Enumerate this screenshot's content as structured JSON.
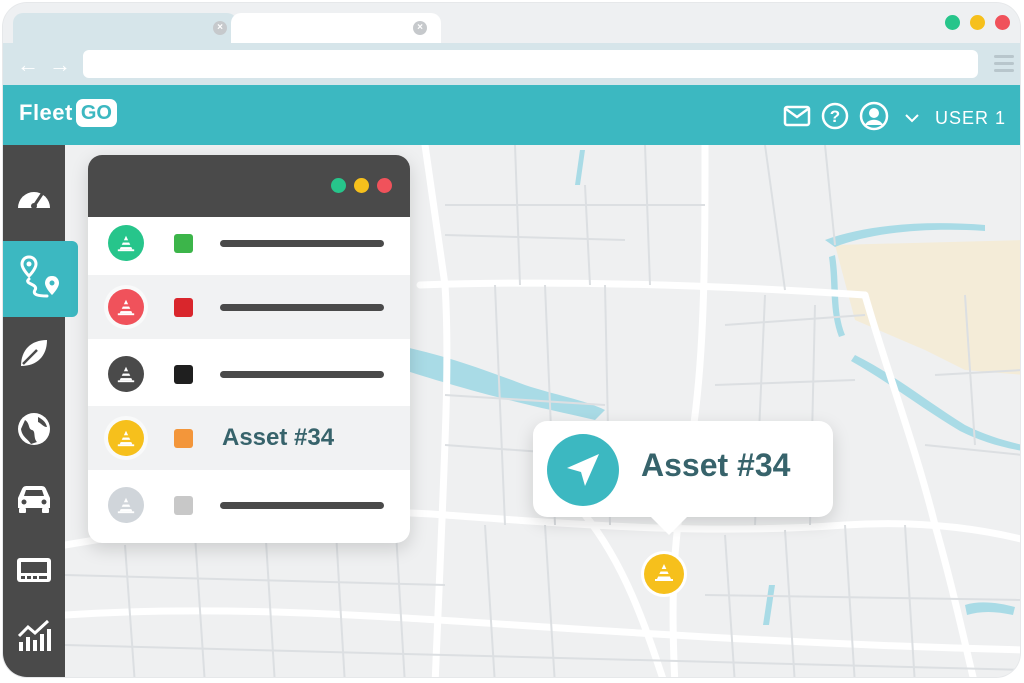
{
  "browser": {
    "tabs": [
      {
        "close_icon": "close-icon"
      },
      {
        "close_icon": "close-icon"
      }
    ],
    "window_controls": {
      "colors": [
        "#27c58b",
        "#f6c01c",
        "#f0525b"
      ]
    },
    "back_icon": "arrow-left-icon",
    "forward_icon": "arrow-right-icon",
    "url": "",
    "menu_icon": "hamburger-icon"
  },
  "header": {
    "logo": {
      "text": "Fleet",
      "badge": "GO"
    },
    "icons": [
      "mail-icon",
      "help-icon",
      "user-icon",
      "chevron-down-icon"
    ],
    "user_label": "USER 1",
    "accent": "#3cb8c1"
  },
  "sidebar": {
    "items": [
      {
        "icon": "speedometer-icon",
        "active": false
      },
      {
        "icon": "route-icon",
        "active": true
      },
      {
        "icon": "leaf-icon",
        "active": false
      },
      {
        "icon": "globe-icon",
        "active": false
      },
      {
        "icon": "car-icon",
        "active": false
      },
      {
        "icon": "display-icon",
        "active": false
      },
      {
        "icon": "chart-icon",
        "active": false
      }
    ]
  },
  "asset_panel": {
    "window_controls": [
      "#27c58b",
      "#f6c01c",
      "#f0525b"
    ],
    "rows": [
      {
        "icon_color": "#27c58b",
        "swatch_color": "#3cb54a",
        "label": ""
      },
      {
        "icon_color": "#f0525b",
        "swatch_color": "#d9262c",
        "label": ""
      },
      {
        "icon_color": "#4a4a4a",
        "swatch_color": "#1f1f1f",
        "label": ""
      },
      {
        "icon_color": "#f6c01c",
        "swatch_color": "#f3963a",
        "label": "Asset #34"
      },
      {
        "icon_color": "#d0d5da",
        "swatch_color": "#c8c8c8",
        "label": ""
      }
    ]
  },
  "map_callout": {
    "icon": "navigation-arrow-icon",
    "label": "Asset #34"
  },
  "map_marker": {
    "icon": "cone-icon",
    "color": "#f6c01c"
  }
}
